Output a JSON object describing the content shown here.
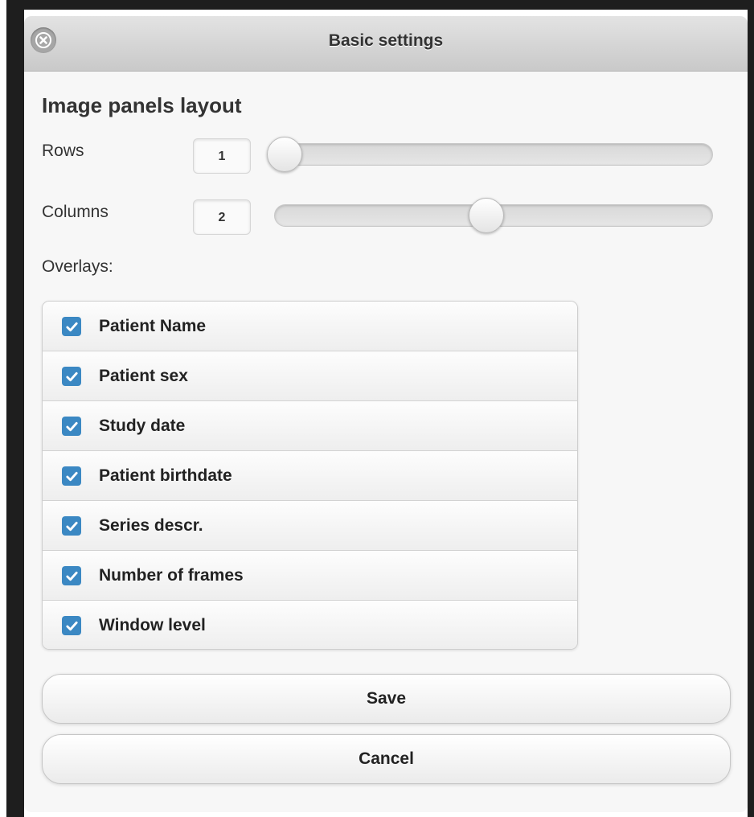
{
  "dialog": {
    "title": "Basic settings",
    "close_icon": "close-circle-icon"
  },
  "layout": {
    "heading": "Image panels layout",
    "rows": {
      "label": "Rows",
      "value": "1",
      "slider_fraction": 0.0
    },
    "columns": {
      "label": "Columns",
      "value": "2",
      "slider_fraction": 0.5
    }
  },
  "overlays": {
    "label": "Overlays:",
    "items": [
      {
        "label": "Patient Name",
        "checked": true
      },
      {
        "label": "Patient sex",
        "checked": true
      },
      {
        "label": "Study date",
        "checked": true
      },
      {
        "label": "Patient birthdate",
        "checked": true
      },
      {
        "label": "Series descr.",
        "checked": true
      },
      {
        "label": "Number of frames",
        "checked": true
      },
      {
        "label": "Window level",
        "checked": true
      }
    ]
  },
  "actions": {
    "save_label": "Save",
    "cancel_label": "Cancel"
  },
  "colors": {
    "checkbox": "#3b88c3",
    "titlebar": "#d4d4d4"
  }
}
